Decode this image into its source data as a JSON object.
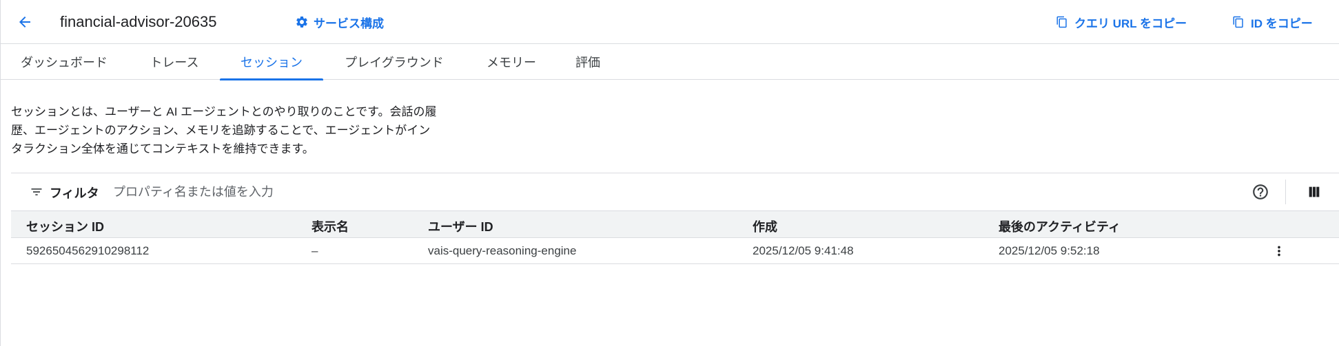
{
  "colors": {
    "accent": "#1a73e8",
    "text": "#202124",
    "muted": "#5f6368",
    "border": "#dadce0",
    "header_bg": "#f1f3f4"
  },
  "header": {
    "back_icon": "arrow-left-icon",
    "title": "financial-advisor-20635",
    "service_config": {
      "icon": "gear-icon",
      "label": "サービス構成"
    },
    "copy_query_url": {
      "icon": "copy-icon",
      "label": "クエリ URL をコピー"
    },
    "copy_id": {
      "icon": "copy-icon",
      "label": "ID をコピー"
    }
  },
  "tabs": [
    {
      "label": "ダッシュボード",
      "active": false
    },
    {
      "label": "トレース",
      "active": false
    },
    {
      "label": "セッション",
      "active": true
    },
    {
      "label": "プレイグラウンド",
      "active": false
    },
    {
      "label": "メモリー",
      "active": false
    },
    {
      "label": "評価",
      "active": false
    }
  ],
  "description": {
    "line1": "セッションとは、ユーザーと AI エージェントとのやり取りのことです。会話の履",
    "line2": "歴、エージェントのアクション、メモリを追跡することで、エージェントがイン",
    "line3": "タラクション全体を通じてコンテキストを維持できます。"
  },
  "filter": {
    "icon": "filter-list-icon",
    "label": "フィルタ",
    "placeholder": "プロパティ名または値を入力",
    "help_icon": "help-circle-icon",
    "columns_icon": "column-view-icon"
  },
  "table": {
    "columns": [
      "セッション ID",
      "表示名",
      "ユーザー ID",
      "作成",
      "最後のアクティビティ"
    ],
    "rows": [
      {
        "session_id": "5926504562910298112",
        "display_name": "–",
        "user_id": "vais-query-reasoning-engine",
        "created": "2025/12/05 9:41:48",
        "last_activity": "2025/12/05 9:52:18",
        "menu_icon": "more-vert-icon"
      }
    ]
  }
}
